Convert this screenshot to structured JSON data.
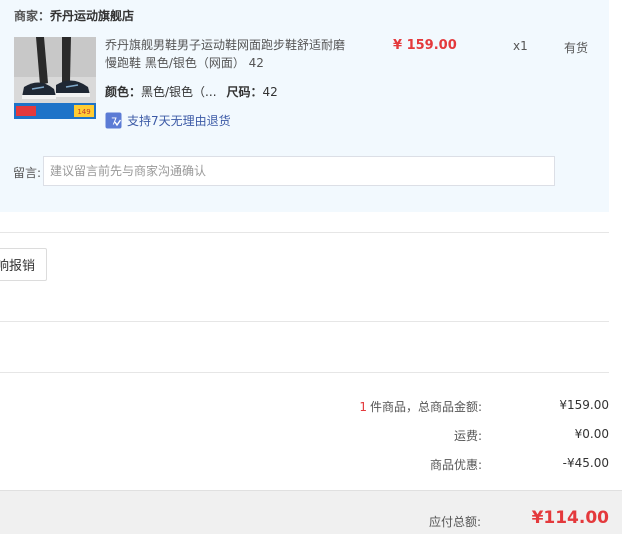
{
  "shop": {
    "label": "商家：",
    "name": "乔丹运动旗舰店"
  },
  "product": {
    "image_badge_left": "官方旗舰店",
    "image_price_tag": "149",
    "title": "乔丹旗舰男鞋男子运动鞋网面跑步鞋舒适耐磨慢跑鞋 黑色/银色（网面） 42",
    "color_label": "颜色：",
    "color_value": "黑色/银色（...",
    "size_label": "尺码：",
    "size_value": "42",
    "return_text": "支持7天无理由退货",
    "price": "¥ 159.00",
    "qty": "x1",
    "stock": "有货"
  },
  "note": {
    "label": "留言:",
    "placeholder": "建议留言前先与商家沟通确认"
  },
  "invoice": {
    "button_label": "响报销"
  },
  "summary": {
    "count": "1",
    "items_label": "件商品，总商品金额:",
    "items_value": "¥159.00",
    "shipping_label": "运费:",
    "shipping_value": "¥0.00",
    "discount_label": "商品优惠:",
    "discount_value": "-¥45.00"
  },
  "total": {
    "label": "应付总额:",
    "value": "¥114.00"
  },
  "colors": {
    "accent_red": "#e4393c",
    "panel_bg": "#f2f9fe",
    "link_blue": "#3c5aa6"
  }
}
